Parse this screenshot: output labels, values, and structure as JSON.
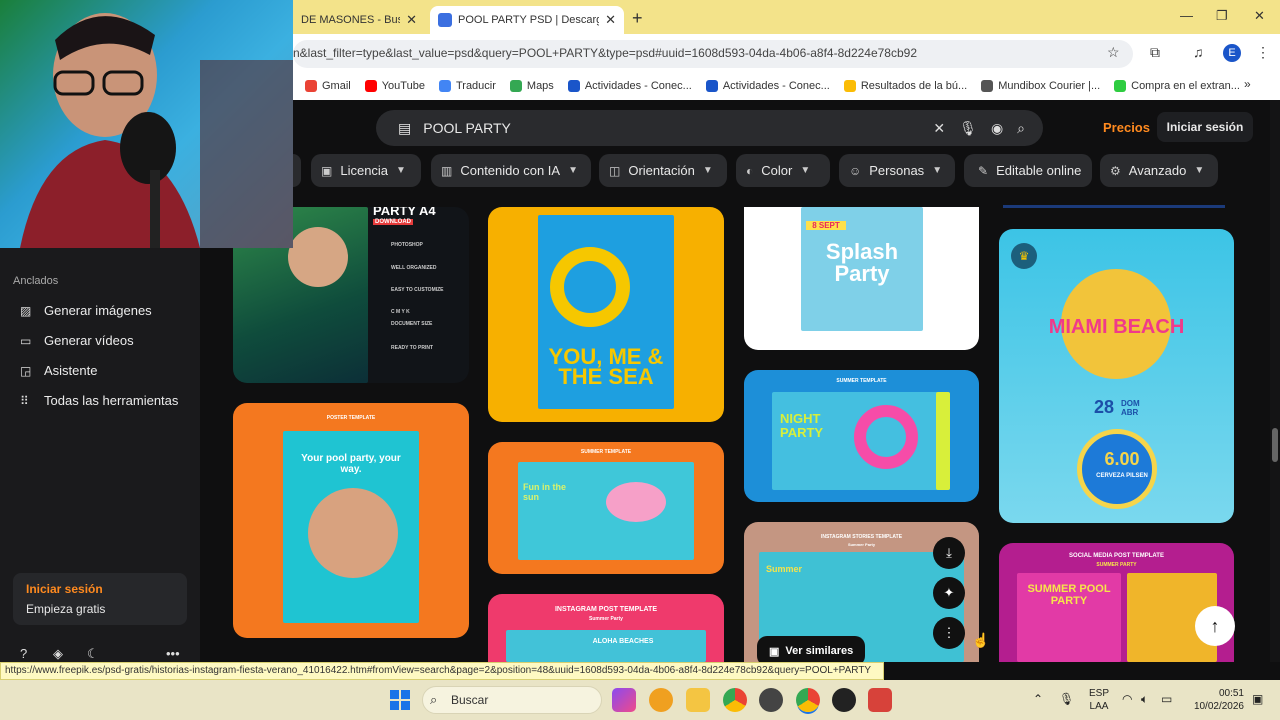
{
  "browser": {
    "tabs": [
      {
        "label": "DE MASONES - Buscar c",
        "active": false
      },
      {
        "label": "POOL PARTY PSD | Descarga gr",
        "active": true
      }
    ],
    "new_tab": "+",
    "url": "n&last_filter=type&last_value=psd&query=POOL+PARTY&type=psd#uuid=1608d593-04da-4b06-a8f4-8d224e78cb92",
    "profile_initial": "E",
    "bookmarks": [
      {
        "label": "Gmail",
        "color": "#ea4335"
      },
      {
        "label": "YouTube",
        "color": "#ff0000"
      },
      {
        "label": "Traducir",
        "color": "#4285f4"
      },
      {
        "label": "Maps",
        "color": "#34a853"
      },
      {
        "label": "Actividades - Conec...",
        "color": "#1a55c9"
      },
      {
        "label": "Actividades - Conec...",
        "color": "#1a55c9"
      },
      {
        "label": "Resultados de la bú...",
        "color": "#fbbc05"
      },
      {
        "label": "Mundibox Courier |...",
        "color": "#555555"
      },
      {
        "label": "Compra en el extran...",
        "color": "#2ecc40"
      }
    ]
  },
  "site": {
    "search_query": "POOL PARTY",
    "pricing_link": "Precios",
    "login_button": "Iniciar sesión",
    "filters": [
      {
        "label": "Licencia",
        "icon": "license-icon"
      },
      {
        "label": "Contenido con IA",
        "icon": "ai-content-icon"
      },
      {
        "label": "Orientación",
        "icon": "orientation-icon"
      },
      {
        "label": "Color",
        "icon": "palette-icon"
      },
      {
        "label": "Personas",
        "icon": "people-icon"
      },
      {
        "label": "Editable online",
        "icon": "pen-icon"
      },
      {
        "label": "Avanzado",
        "icon": "gear-icon"
      }
    ],
    "sidebar": {
      "pinned_heading": "Anclados",
      "items": [
        {
          "label": "Generar imágenes",
          "icon": "image-icon"
        },
        {
          "label": "Generar vídeos",
          "icon": "video-icon"
        },
        {
          "label": "Asistente",
          "icon": "assistant-icon"
        },
        {
          "label": "Todas las herramientas",
          "icon": "grid-icon"
        }
      ],
      "login": "Iniciar sesión",
      "signup": "Empieza gratis"
    },
    "results": {
      "hover_action": "Ver similares",
      "cards": [
        {
          "headline": "PARTY A4",
          "subtitle": "DOWNLOAD",
          "features": [
            "PHOTOSHOP",
            "WELL ORGANIZED",
            "EASY TO CUSTOMIZE",
            "C M Y K",
            "DOCUMENT SIZE",
            "READY TO PRINT"
          ]
        },
        {
          "headline": "YOU, ME & THE SEA"
        },
        {
          "headline": "Splash Party",
          "date": "8 SEPT"
        },
        {
          "headline": "MIAMI BEACH",
          "date_day": "28",
          "date_label": "DOM ABR",
          "price": "6.00",
          "price_label": "CERVEZA PILSEN"
        },
        {
          "label": "POSTER TEMPLATE",
          "headline": "Your pool party, your way."
        },
        {
          "label": "SUMMER TEMPLATE",
          "headline": "Fun in the sun"
        },
        {
          "label": "SUMMER TEMPLATE",
          "headline": "NIGHT PARTY"
        },
        {
          "label": "INSTAGRAM POST TEMPLATE",
          "sublabel": "Summer Party",
          "headline": "ALOHA BEACHES"
        },
        {
          "label": "INSTAGRAM STORIES TEMPLATE",
          "sublabel": "Summer Party",
          "headline": "Summer"
        },
        {
          "label": "SOCIAL MEDIA POST TEMPLATE",
          "sublabel": "SUMMER PARTY",
          "headline": "SUMMER POOL PARTY"
        }
      ]
    }
  },
  "status_url": "https://www.freepik.es/psd-gratis/historias-instagram-fiesta-verano_41016422.htm#fromView=search&page=2&position=48&uuid=1608d593-04da-4b06-a8f4-8d224e78cb92&query=POOL+PARTY",
  "taskbar": {
    "search_placeholder": "Buscar",
    "language": "ESP",
    "layout": "LAA",
    "time": "00:51",
    "date": "10/02/2026"
  }
}
